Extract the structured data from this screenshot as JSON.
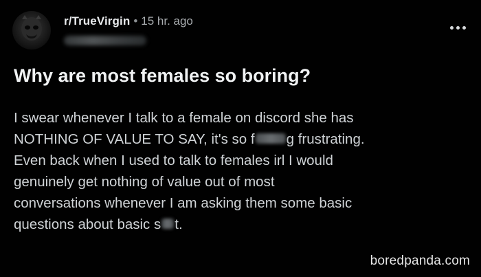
{
  "post": {
    "subreddit": "r/TrueVirgin",
    "separator": "•",
    "time": "15 hr. ago",
    "title": "Why are most females so boring?",
    "body": {
      "line1": "I swear whenever I talk to a female on discord she has",
      "line2_before": "NOTHING OF VALUE TO SAY, it's so f",
      "line2_after": "g frustrating.",
      "line3": "Even back when I used to talk to females irl I would",
      "line4": "genuinely get nothing of value out of most",
      "line5": "conversations whenever I am asking them some basic",
      "line6_before": "questions about basic s",
      "line6_after": "t."
    }
  },
  "icons": {
    "avatar": "avatar-image",
    "more": "more-options-icon"
  },
  "watermark": "boredpanda.com",
  "colors": {
    "background": "#010101",
    "text": "#d7dadc",
    "title": "#f0f2f3"
  }
}
